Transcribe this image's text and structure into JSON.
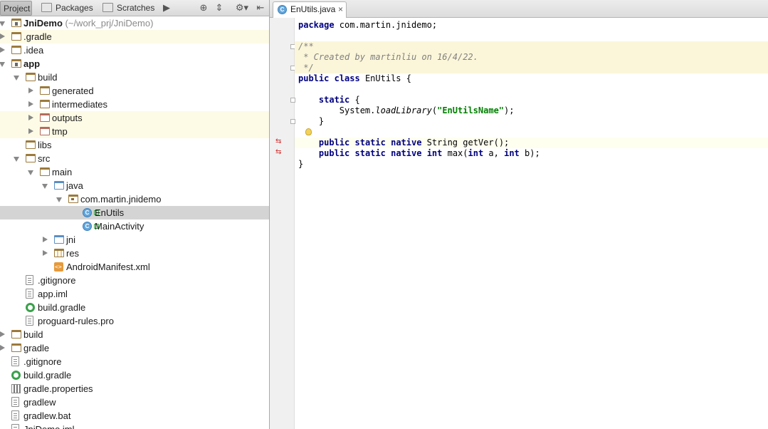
{
  "project_panel": {
    "tabs": [
      {
        "label": "Project",
        "icon": "project-view-icon",
        "active": true
      },
      {
        "label": "Packages",
        "icon": "packages-view-icon",
        "active": false
      },
      {
        "label": "Scratches",
        "icon": "scratches-view-icon",
        "active": false
      }
    ],
    "tools": [
      "more-tabs-icon",
      "scroll-from-source-icon",
      "collapse-all-icon",
      "settings-gear-icon",
      "hide-panel-icon"
    ],
    "tree": [
      {
        "label": "JniDemo",
        "suffix": "(~/work_prj/JniDemo)",
        "icon": "module-folder",
        "depth": 0,
        "arrow": "down",
        "bold": true
      },
      {
        "label": ".gradle",
        "icon": "folder",
        "depth": 0,
        "arrow": "right",
        "highlight": true
      },
      {
        "label": ".idea",
        "icon": "folder",
        "depth": 0,
        "arrow": "right"
      },
      {
        "label": "app",
        "icon": "module-folder",
        "depth": 0,
        "arrow": "down",
        "bold": true
      },
      {
        "label": "build",
        "icon": "folder",
        "depth": 1,
        "arrow": "down"
      },
      {
        "label": "generated",
        "icon": "folder",
        "depth": 2,
        "arrow": "right"
      },
      {
        "label": "intermediates",
        "icon": "folder",
        "depth": 2,
        "arrow": "right"
      },
      {
        "label": "outputs",
        "icon": "folder-excluded",
        "depth": 2,
        "arrow": "right",
        "highlight": true
      },
      {
        "label": "tmp",
        "icon": "folder-excluded",
        "depth": 2,
        "arrow": "right",
        "highlight": true
      },
      {
        "label": "libs",
        "icon": "folder",
        "depth": 1,
        "arrow": "none"
      },
      {
        "label": "src",
        "icon": "folder",
        "depth": 1,
        "arrow": "down"
      },
      {
        "label": "main",
        "icon": "folder",
        "depth": 2,
        "arrow": "down"
      },
      {
        "label": "java",
        "icon": "folder-source",
        "depth": 3,
        "arrow": "down"
      },
      {
        "label": "com.martin.jnidemo",
        "icon": "package",
        "depth": 4,
        "arrow": "down"
      },
      {
        "label": "EnUtils",
        "icon": "class",
        "depth": 5,
        "arrow": "none",
        "selected": true
      },
      {
        "label": "MainActivity",
        "icon": "class",
        "depth": 5,
        "arrow": "none"
      },
      {
        "label": "jni",
        "icon": "folder-source",
        "depth": 3,
        "arrow": "right"
      },
      {
        "label": "res",
        "icon": "folder-resources",
        "depth": 3,
        "arrow": "right"
      },
      {
        "label": "AndroidManifest.xml",
        "icon": "xml-file",
        "depth": 3,
        "arrow": "none"
      },
      {
        "label": ".gitignore",
        "icon": "text-file",
        "depth": 1,
        "arrow": "none"
      },
      {
        "label": "app.iml",
        "icon": "iml-file",
        "depth": 1,
        "arrow": "none"
      },
      {
        "label": "build.gradle",
        "icon": "gradle-file",
        "depth": 1,
        "arrow": "none"
      },
      {
        "label": "proguard-rules.pro",
        "icon": "text-file",
        "depth": 1,
        "arrow": "none"
      },
      {
        "label": "build",
        "icon": "folder",
        "depth": 0,
        "arrow": "right"
      },
      {
        "label": "gradle",
        "icon": "folder",
        "depth": 0,
        "arrow": "right"
      },
      {
        "label": ".gitignore",
        "icon": "text-file",
        "depth": 0,
        "arrow": "none"
      },
      {
        "label": "build.gradle",
        "icon": "gradle-file",
        "depth": 0,
        "arrow": "none"
      },
      {
        "label": "gradle.properties",
        "icon": "properties-file",
        "depth": 0,
        "arrow": "none"
      },
      {
        "label": "gradlew",
        "icon": "text-file",
        "depth": 0,
        "arrow": "none"
      },
      {
        "label": "gradlew.bat",
        "icon": "text-file",
        "depth": 0,
        "arrow": "none"
      },
      {
        "label": "JniDemo.iml",
        "icon": "iml-file",
        "depth": 0,
        "arrow": "none"
      }
    ]
  },
  "editor": {
    "tab": {
      "label": "EnUtils.java",
      "icon": "class-icon",
      "close": "×"
    },
    "code_lines": [
      {
        "tokens": [
          {
            "t": "package",
            "c": "kw"
          },
          {
            "t": " com.martin.jnidemo;"
          }
        ]
      },
      {
        "tokens": []
      },
      {
        "tokens": [
          {
            "t": "/**",
            "c": "cm"
          }
        ],
        "highlight": true
      },
      {
        "tokens": [
          {
            "t": " * Created by ",
            "c": "cm"
          },
          {
            "t": "martinliu",
            "c": "cm"
          },
          {
            "t": " on 16/4/22.",
            "c": "cm"
          }
        ],
        "highlight": true
      },
      {
        "tokens": [
          {
            "t": " */",
            "c": "cm"
          }
        ],
        "highlight": true
      },
      {
        "tokens": [
          {
            "t": "public",
            "c": "kw"
          },
          {
            "t": " "
          },
          {
            "t": "class",
            "c": "kw"
          },
          {
            "t": " EnUtils {"
          }
        ]
      },
      {
        "tokens": []
      },
      {
        "tokens": [
          {
            "t": "    "
          },
          {
            "t": "static",
            "c": "kw"
          },
          {
            "t": " {"
          }
        ]
      },
      {
        "tokens": [
          {
            "t": "        System."
          },
          {
            "t": "loadLibrary",
            "c": "meth"
          },
          {
            "t": "("
          },
          {
            "t": "\"EnUtilsName\"",
            "c": "str"
          },
          {
            "t": ");"
          }
        ]
      },
      {
        "tokens": [
          {
            "t": "    }"
          }
        ]
      },
      {
        "tokens": []
      },
      {
        "tokens": [
          {
            "t": "    "
          },
          {
            "t": "public",
            "c": "kw"
          },
          {
            "t": " "
          },
          {
            "t": "static",
            "c": "kw"
          },
          {
            "t": " "
          },
          {
            "t": "native",
            "c": "kw"
          },
          {
            "t": " String getVer();"
          }
        ],
        "current": true
      },
      {
        "tokens": [
          {
            "t": "    "
          },
          {
            "t": "public",
            "c": "kw"
          },
          {
            "t": " "
          },
          {
            "t": "static",
            "c": "kw"
          },
          {
            "t": " "
          },
          {
            "t": "native",
            "c": "kw"
          },
          {
            "t": " "
          },
          {
            "t": "int",
            "c": "kw"
          },
          {
            "t": " max("
          },
          {
            "t": "int",
            "c": "kw"
          },
          {
            "t": " a, "
          },
          {
            "t": "int",
            "c": "kw"
          },
          {
            "t": " b);"
          }
        ]
      },
      {
        "tokens": [
          {
            "t": "}"
          }
        ]
      }
    ],
    "gutter_markers": [
      {
        "line": 11,
        "icon": "native-impl-icon"
      },
      {
        "line": 12,
        "icon": "native-impl-icon"
      },
      {
        "line": 10,
        "icon": "intention-bulb-icon"
      }
    ]
  },
  "colors": {
    "keyword": "#000080",
    "comment": "#808080",
    "string": "#008000",
    "selection": "#d4d4d4",
    "highlight": "#fbf6d9"
  }
}
